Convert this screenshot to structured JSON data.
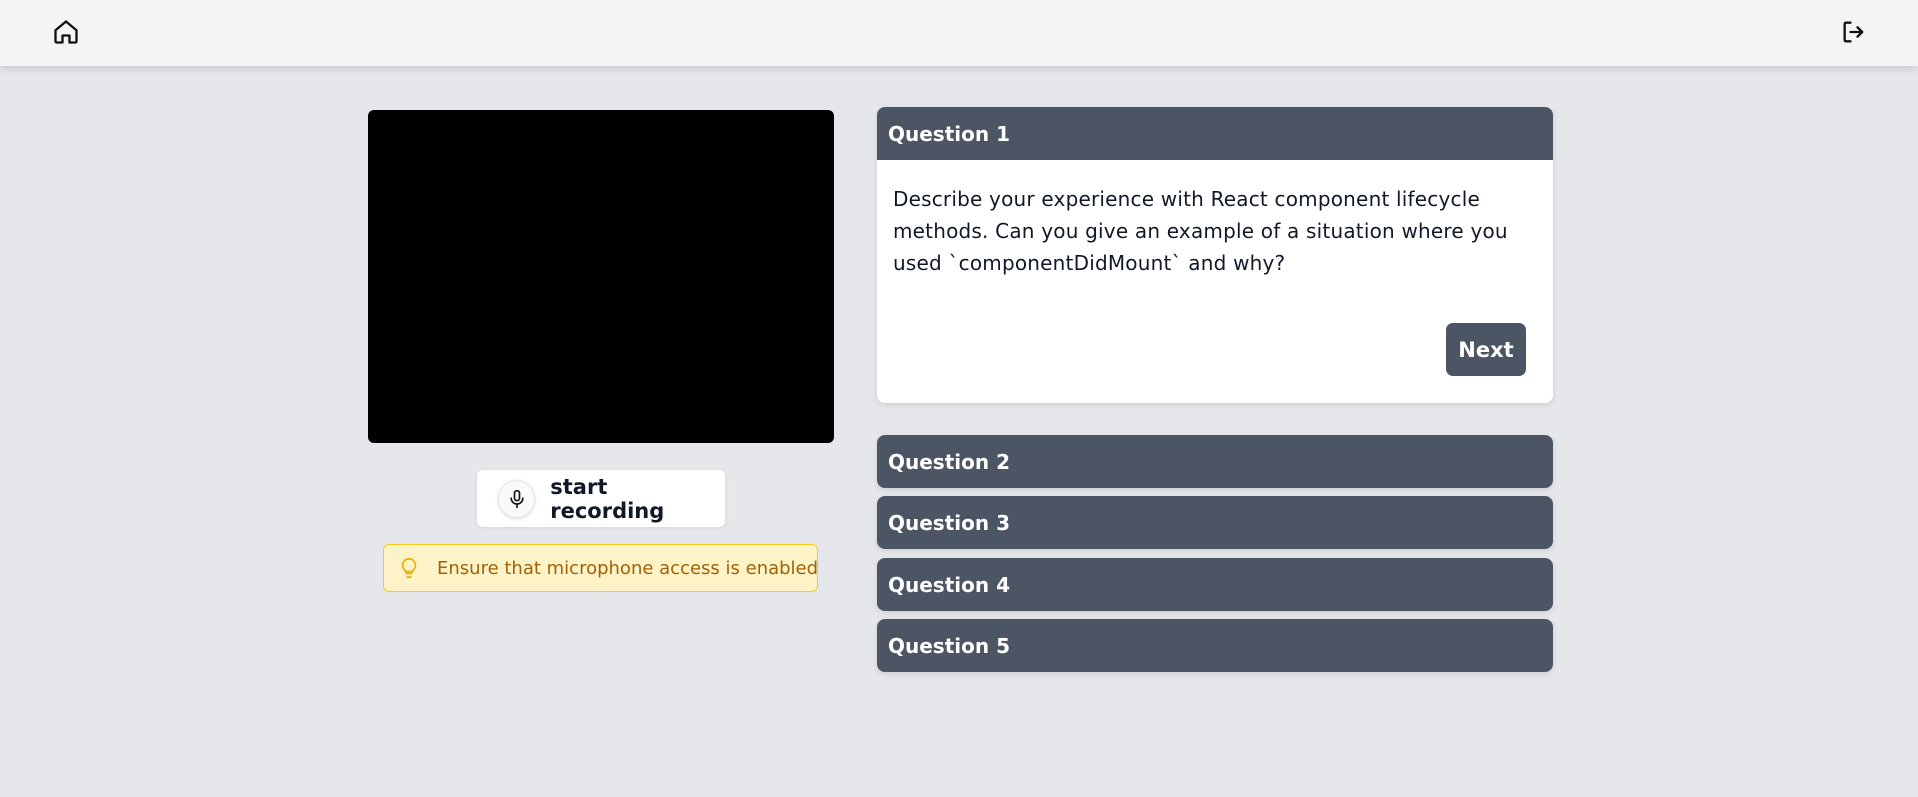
{
  "header": {
    "home_icon": "home-icon",
    "logout_icon": "logout-icon"
  },
  "recorder": {
    "button_label": "start recording",
    "mic_icon": "microphone-icon"
  },
  "tip": {
    "icon": "lightbulb-icon",
    "text": "Ensure that microphone access is enabled"
  },
  "questions": {
    "active": {
      "title": "Question 1",
      "text": "Describe your experience with React component lifecycle methods. Can you give an example of a situation where you used `componentDidMount` and why?",
      "next_label": "Next"
    },
    "collapsed": [
      {
        "title": "Question 2"
      },
      {
        "title": "Question 3"
      },
      {
        "title": "Question 4"
      },
      {
        "title": "Question 5"
      }
    ]
  },
  "colors": {
    "page_bg": "#e5e7eb",
    "header_bg": "#f3f4f6",
    "accordion_header": "#4b5563",
    "tip_bg": "#fef3c7",
    "tip_border": "#facc15",
    "tip_text": "#a16207"
  }
}
